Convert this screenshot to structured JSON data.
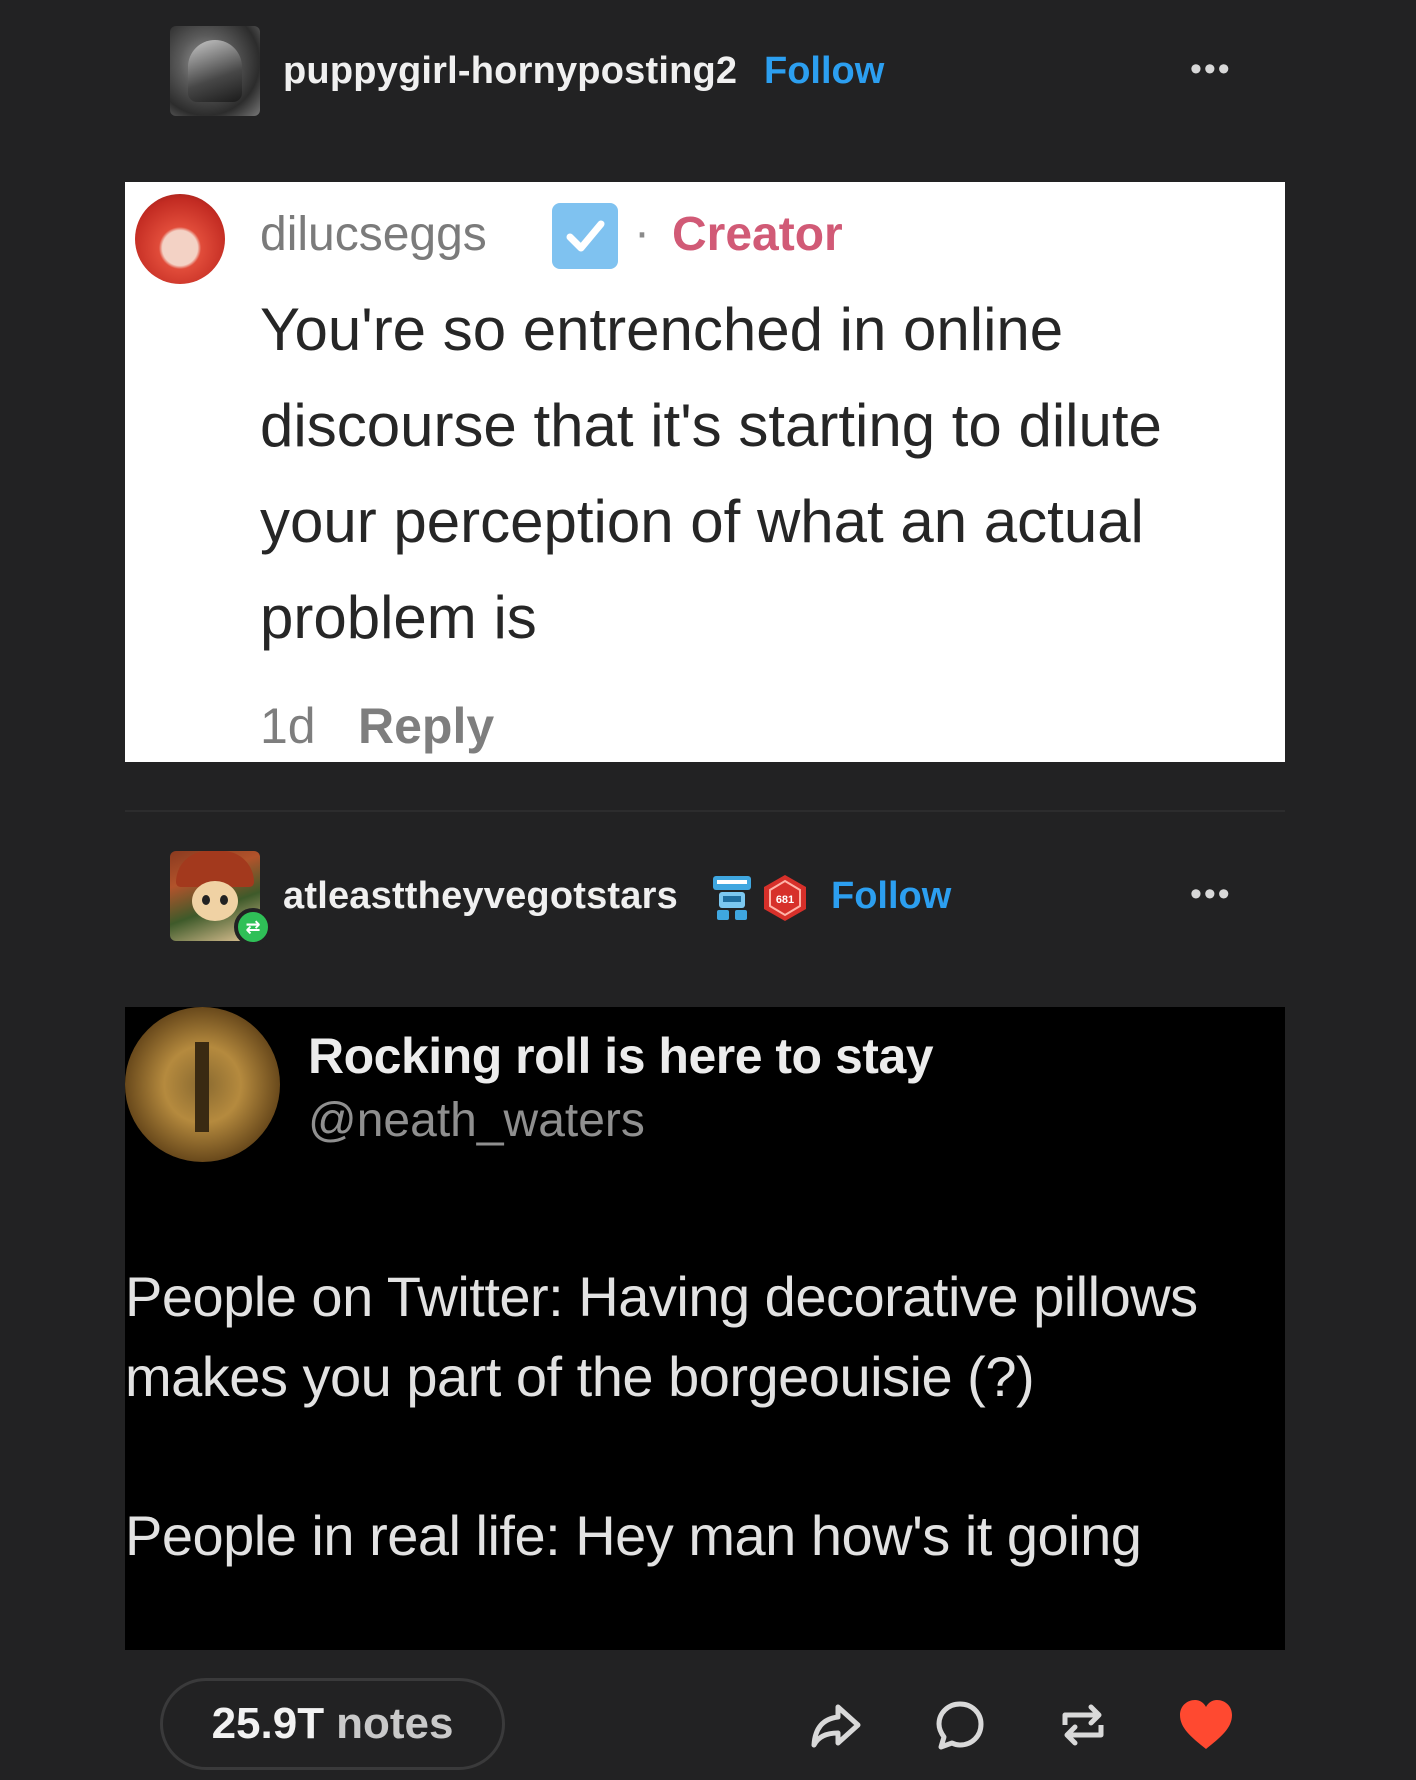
{
  "post1": {
    "username": "puppygirl-hornyposting2",
    "follow_label": "Follow",
    "more_label": "•••"
  },
  "comment_card": {
    "username": "dilucseggs",
    "separator": "·",
    "role": "Creator",
    "text": "You're so entrenched in online discourse that it's starting to dilute your perception of what an actual problem is",
    "time": "1d",
    "reply_label": "Reply"
  },
  "post2": {
    "username": "atleasttheyvegotstars",
    "follow_label": "Follow",
    "more_label": "•••",
    "badge_text": "681"
  },
  "tweet_card": {
    "display_name": "Rocking roll is here to stay",
    "handle": "@neath_waters",
    "line1": "People on Twitter: Having decorative pillows makes you part of the borgeouisie (?)",
    "line2": "People in real life: Hey man how's it going"
  },
  "footer": {
    "notes_count": "25.9T",
    "notes_label": "notes",
    "icons": [
      "share-icon",
      "comment-icon",
      "reblog-icon",
      "heart-icon"
    ]
  },
  "colors": {
    "background": "#222223",
    "follow": "#2c9ff0",
    "creator": "#d15a76",
    "heart": "#ff4930",
    "reblog_badge": "#2fc057"
  }
}
